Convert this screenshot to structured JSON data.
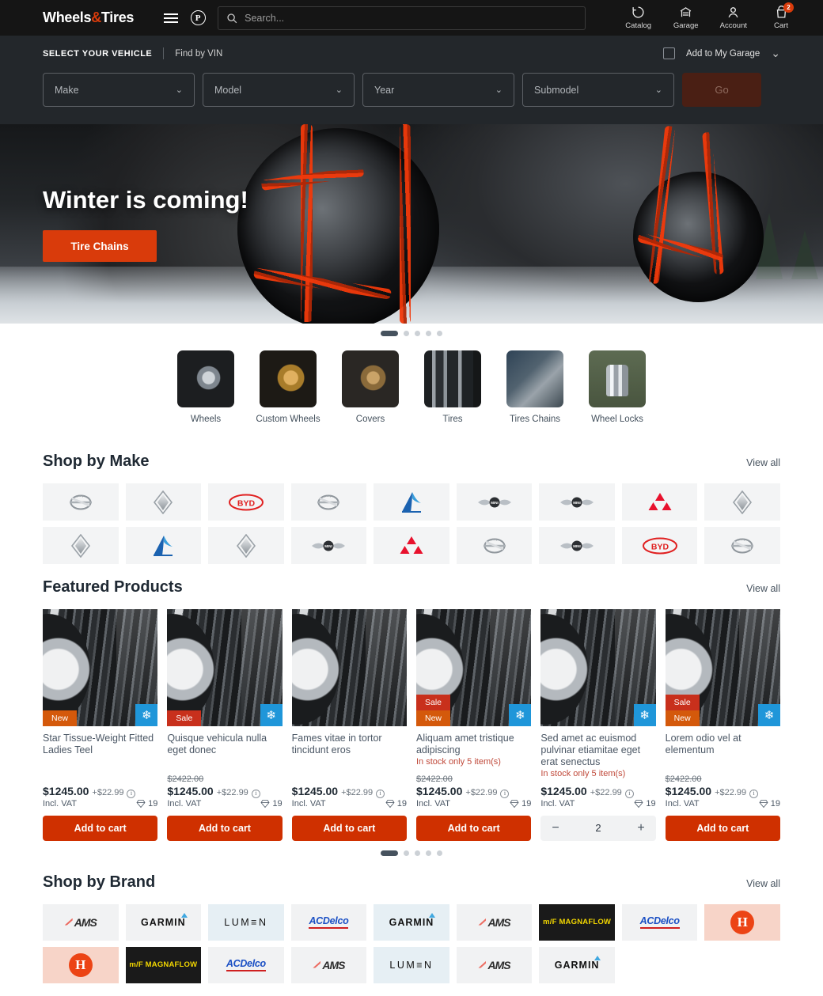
{
  "header": {
    "logo_main": "Wheels",
    "logo_amp": "&",
    "logo_sub": "Tires",
    "menu_icon": "hamburger-icon",
    "paypal_icon": "paypal-icon",
    "search": {
      "placeholder": "Search...",
      "value": "",
      "icon": "search-icon"
    },
    "actions": [
      {
        "label": "Catalog",
        "icon": "catalog-icon",
        "badge": ""
      },
      {
        "label": "Garage",
        "icon": "garage-icon",
        "badge": ""
      },
      {
        "label": "Account",
        "icon": "account-icon",
        "badge": ""
      },
      {
        "label": "Cart",
        "icon": "cart-icon",
        "badge": "2"
      }
    ]
  },
  "vehicle_selector": {
    "title": "SELECT YOUR VEHICLE",
    "find_by_vin": "Find by VIN",
    "add_to_garage": "Add to My Garage",
    "checkbox_checked": false,
    "collapse_icon": "chevron-down-icon",
    "selects": [
      {
        "placeholder": "Make",
        "value": ""
      },
      {
        "placeholder": "Model",
        "value": ""
      },
      {
        "placeholder": "Year",
        "value": ""
      },
      {
        "placeholder": "Submodel",
        "value": ""
      }
    ],
    "go_label": "Go"
  },
  "hero": {
    "headline": "Winter is coming!",
    "cta_label": "Tire Chains",
    "slide_count": 5,
    "active_slide": 1
  },
  "categories": [
    {
      "label": "Wheels",
      "art": "cimg-wheels"
    },
    {
      "label": "Custom Wheels",
      "art": "cimg-custom"
    },
    {
      "label": "Covers",
      "art": "cimg-covers"
    },
    {
      "label": "Tires",
      "art": "cimg-tires"
    },
    {
      "label": "Tires Chains",
      "art": "cimg-chains"
    },
    {
      "label": "Wheel Locks",
      "art": "cimg-locks"
    }
  ],
  "shop_by_make": {
    "title": "Shop by Make",
    "view_all": "View all",
    "makes": [
      "opel",
      "renault",
      "byd",
      "opel",
      "alpine",
      "mini",
      "mini",
      "mitsubishi",
      "renault",
      "renault",
      "alpine",
      "renault",
      "mini",
      "mitsubishi",
      "opel",
      "mini",
      "byd",
      "opel"
    ]
  },
  "featured_products": {
    "title": "Featured Products",
    "view_all": "View all",
    "cart_label": "Add to cart",
    "snowflake_icon": "snowflake-icon",
    "points_icon": "gem-icon",
    "info_icon": "info-icon",
    "slide_count": 5,
    "active_slide": 1,
    "items": [
      {
        "name": "Star Tissue-Weight Fitted Ladies Teel",
        "badges": [
          "New"
        ],
        "snowflake": true,
        "old_price": "",
        "price": "$1245.00",
        "extra": "+$22.99",
        "vat": "Incl. VAT",
        "points": "19",
        "stock": "",
        "control": "button"
      },
      {
        "name": "Quisque vehicula nulla eget donec",
        "badges": [
          "Sale"
        ],
        "snowflake": true,
        "old_price": "$2422.00",
        "price": "$1245.00",
        "extra": "+$22.99",
        "vat": "Incl. VAT",
        "points": "19",
        "stock": "",
        "control": "button"
      },
      {
        "name": "Fames vitae in tortor tincidunt eros",
        "badges": [],
        "snowflake": false,
        "old_price": "",
        "price": "$1245.00",
        "extra": "+$22.99",
        "vat": "Incl. VAT",
        "points": "19",
        "stock": "",
        "control": "button"
      },
      {
        "name": "Aliquam amet tristique adipiscing",
        "badges": [
          "Sale",
          "New"
        ],
        "snowflake": true,
        "old_price": "$2422.00",
        "price": "$1245.00",
        "extra": "+$22.99",
        "vat": "Incl. VAT",
        "points": "19",
        "stock": "In stock only 5 item(s)",
        "control": "button"
      },
      {
        "name": "Sed amet ac euismod pulvinar etiamitae eget erat senectus",
        "badges": [],
        "snowflake": true,
        "old_price": "",
        "price": "$1245.00",
        "extra": "+$22.99",
        "vat": "Incl. VAT",
        "points": "19",
        "stock": "In stock only 5 item(s)",
        "control": "stepper",
        "quantity": "2"
      },
      {
        "name": "Lorem odio vel at elementum",
        "badges": [
          "Sale",
          "New"
        ],
        "snowflake": true,
        "old_price": "$2422.00",
        "price": "$1245.00",
        "extra": "+$22.99",
        "vat": "Incl. VAT",
        "points": "19",
        "stock": "",
        "control": "button"
      }
    ]
  },
  "shop_by_brand": {
    "title": "Shop by Brand",
    "view_all": "View all",
    "brands": [
      {
        "name": "AMS",
        "style": "light"
      },
      {
        "name": "GARMIN",
        "style": "light"
      },
      {
        "name": "LUMEN",
        "style": "blue"
      },
      {
        "name": "ACDelco",
        "style": "light"
      },
      {
        "name": "GARMIN",
        "style": "blue"
      },
      {
        "name": "AMS",
        "style": "light"
      },
      {
        "name": "MAGNAFLOW",
        "style": "dark"
      },
      {
        "name": "ACDelco",
        "style": "light"
      },
      {
        "name": "Holley",
        "style": "peach"
      },
      {
        "name": "Holley",
        "style": "peach"
      },
      {
        "name": "MAGNAFLOW",
        "style": "dark"
      },
      {
        "name": "ACDelco",
        "style": "light"
      },
      {
        "name": "AMS",
        "style": "light"
      },
      {
        "name": "LUMEN",
        "style": "blue"
      },
      {
        "name": "AMS",
        "style": "light"
      },
      {
        "name": "GARMIN",
        "style": "light"
      }
    ]
  },
  "colors": {
    "accent_red": "#cf3000",
    "badge_sale": "#c8301c",
    "badge_new": "#d4590b",
    "snow_blue": "#1f96d9",
    "header_bg": "#151515",
    "vehbar_bg": "#23272b"
  }
}
